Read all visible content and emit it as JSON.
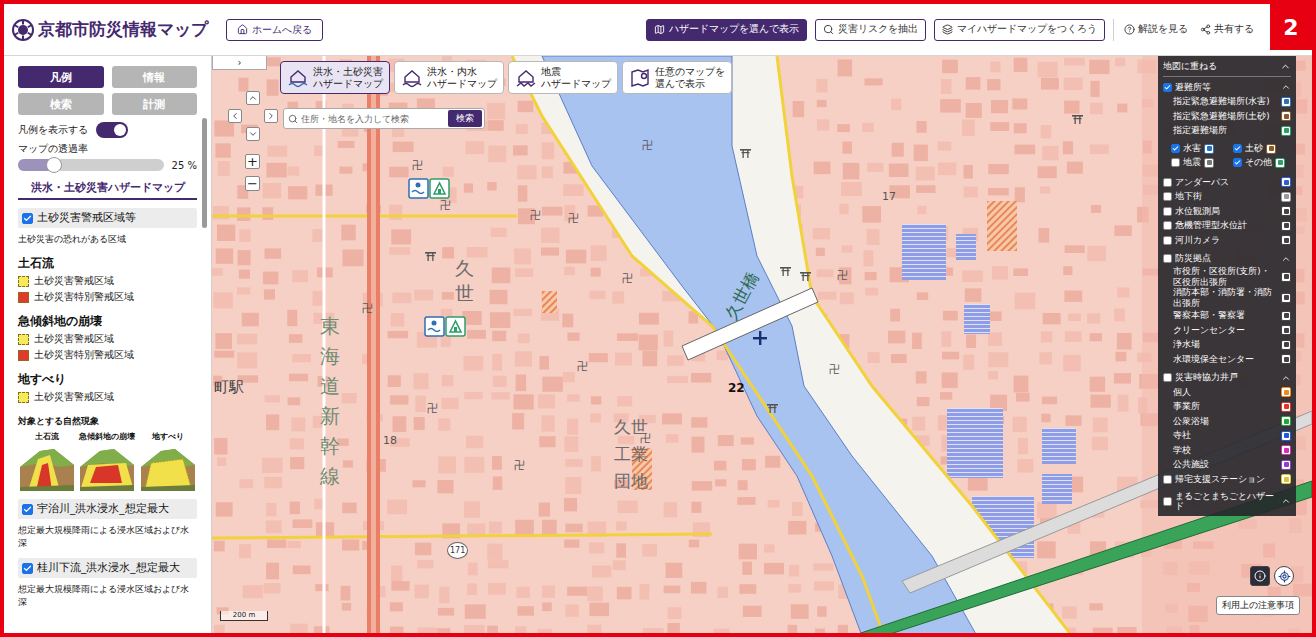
{
  "header": {
    "title": "京都市防災情報マップ",
    "home": "ホームへ戻る",
    "actions": [
      {
        "label": "ハザードマップを選んで表示",
        "primary": true
      },
      {
        "label": "災害リスクを抽出",
        "primary": false
      },
      {
        "label": "マイハザードマップをつくろう",
        "primary": false
      }
    ],
    "links": [
      "解説を見る",
      "共有する"
    ],
    "badge": "2"
  },
  "sidebar": {
    "tabs": [
      {
        "label": "凡例",
        "selected": true
      },
      {
        "label": "情報",
        "selected": false
      },
      {
        "label": "検索",
        "selected": false
      },
      {
        "label": "計測",
        "selected": false
      }
    ],
    "legend_toggle": {
      "label": "凡例を表示する",
      "on": true
    },
    "opacity": {
      "label": "マップの透過率",
      "level": 0.25,
      "reading": "25 %"
    },
    "section_title": "洪水・土砂災害ハザードマップ",
    "layers": [
      {
        "label": "土砂災害警戒区域等",
        "checked": true,
        "description": "土砂災害の恐れがある区域",
        "groups": [
          {
            "title": "土石流",
            "items": [
              {
                "label": "土砂災害警戒区域",
                "color": "#f5ea5a"
              },
              {
                "label": "土砂災害特別警戒区域",
                "color": "#e03a2a"
              }
            ]
          },
          {
            "title": "急傾斜地の崩壊",
            "items": [
              {
                "label": "土砂災害警戒区域",
                "color": "#f5ea5a"
              },
              {
                "label": "土砂災害特別警戒区域",
                "color": "#e03a2a"
              }
            ]
          },
          {
            "title": "地すべり",
            "items": [
              {
                "label": "土砂災害警戒区域",
                "color": "#f5ea5a"
              }
            ]
          }
        ],
        "phenomena": {
          "title": "対象とする自然現象",
          "labels": [
            "土石流",
            "急傾斜地の崩壊",
            "地すべり"
          ]
        }
      },
      {
        "label": "宇治川_洪水浸水_想定最大",
        "checked": true,
        "description": "想定最大規模降雨による浸水区域および水深"
      },
      {
        "label": "桂川下流_洪水浸水_想定最大",
        "checked": true,
        "description": "想定最大規模降雨による浸水区域および水深"
      }
    ]
  },
  "map": {
    "collapse": "›",
    "tabs": [
      {
        "lines": [
          "洪水・土砂災害",
          "ハザードマップ"
        ],
        "selected": true
      },
      {
        "lines": [
          "洪水・内水",
          "ハザードマップ"
        ],
        "selected": false
      },
      {
        "lines": [
          "地震",
          "ハザードマップ"
        ],
        "selected": false
      },
      {
        "lines": [
          "任意のマップを",
          "選んで表示"
        ],
        "selected": false
      }
    ],
    "search": {
      "placeholder": "住所・地名を入力して検索",
      "button": "検索"
    },
    "zoom": [
      "+",
      "−"
    ],
    "labels": [
      {
        "text": "久世",
        "kind": "vertical"
      },
      {
        "text": "東海道新幹線",
        "kind": "line"
      },
      {
        "text": "久世工業団地",
        "kind": "block"
      },
      {
        "text": "久世橋",
        "kind": "bridge"
      },
      {
        "text": "町駅",
        "kind": "station"
      },
      {
        "text": "17",
        "kind": "number"
      },
      {
        "text": "18",
        "kind": "number"
      },
      {
        "text": "22",
        "kind": "route"
      },
      {
        "text": "171",
        "kind": "shield"
      }
    ],
    "temple_mark": "卍",
    "scale": "200 m",
    "notice": "利用上の注意事項"
  },
  "overlay_panel": {
    "title": "地図に重ねる",
    "items": [
      {
        "kind": "group",
        "label": "避難所等",
        "checked": true,
        "expanded": true
      },
      {
        "kind": "legend",
        "label": "指定緊急避難場所(水害)",
        "color": "#2f6fb5"
      },
      {
        "kind": "legend",
        "label": "指定緊急避難場所(土砂)",
        "color": "#8a5a2b"
      },
      {
        "kind": "legend",
        "label": "指定避難場所",
        "color": "#2e9e6a"
      },
      {
        "kind": "filters",
        "options": [
          {
            "label": "水害",
            "checked": true,
            "color": "#2f6fb5"
          },
          {
            "label": "土砂",
            "checked": true,
            "color": "#8a5a2b"
          },
          {
            "label": "地震",
            "checked": false,
            "color": "#777777"
          },
          {
            "label": "その他",
            "checked": true,
            "color": "#2e9e6a"
          }
        ]
      },
      {
        "kind": "check",
        "label": "アンダーパス",
        "checked": false,
        "color": "#2f5fd0"
      },
      {
        "kind": "check",
        "label": "地下街",
        "checked": false,
        "color": "#9a9a9a"
      },
      {
        "kind": "check",
        "label": "水位観測局",
        "checked": false,
        "color": "#444444"
      },
      {
        "kind": "check",
        "label": "危機管理型水位計",
        "checked": false,
        "color": "#444444"
      },
      {
        "kind": "check",
        "label": "河川カメラ",
        "checked": false,
        "color": "#444444"
      },
      {
        "kind": "group",
        "label": "防災拠点",
        "checked": false,
        "expanded": true
      },
      {
        "kind": "legend",
        "label": "市役所・区役所(支所)・区役所出張所",
        "color": "#444444"
      },
      {
        "kind": "legend",
        "label": "消防本部・消防署・消防出張所",
        "color": "#444444"
      },
      {
        "kind": "legend",
        "label": "警察本部・警察署",
        "color": "#444444"
      },
      {
        "kind": "legend",
        "label": "クリーンセンター",
        "color": "#444444"
      },
      {
        "kind": "legend",
        "label": "浄水場",
        "color": "#444444"
      },
      {
        "kind": "legend",
        "label": "水環境保全センター",
        "color": "#444444"
      },
      {
        "kind": "group",
        "label": "災害時協力井戸",
        "checked": false,
        "expanded": true
      },
      {
        "kind": "legend",
        "label": "個人",
        "color": "#f08a1c"
      },
      {
        "kind": "legend",
        "label": "事業所",
        "color": "#e2342b"
      },
      {
        "kind": "legend",
        "label": "公衆浴場",
        "color": "#22a63a"
      },
      {
        "kind": "legend",
        "label": "寺社",
        "color": "#2157e0"
      },
      {
        "kind": "legend",
        "label": "学校",
        "color": "#d52fb6"
      },
      {
        "kind": "legend",
        "label": "公共施設",
        "color": "#8e3fd0"
      },
      {
        "kind": "check",
        "label": "帰宅支援ステーション",
        "checked": false,
        "color": "#d8c23a"
      },
      {
        "kind": "group",
        "label": "まるごとまちごとハザード",
        "checked": false,
        "expanded": true
      }
    ]
  }
}
